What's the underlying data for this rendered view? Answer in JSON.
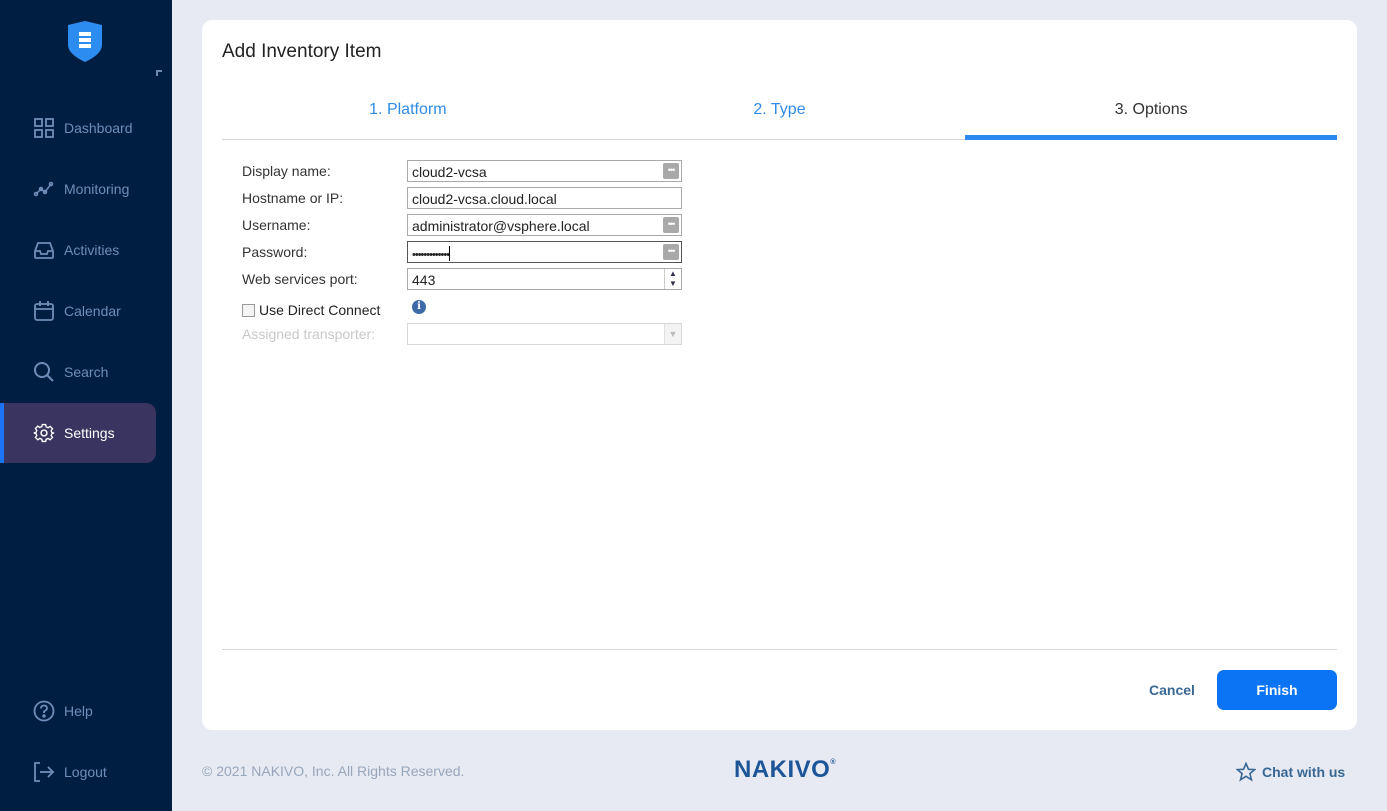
{
  "sidebar": {
    "items": [
      {
        "label": "Dashboard",
        "icon": "dashboard-grid-icon"
      },
      {
        "label": "Monitoring",
        "icon": "monitoring-chart-icon"
      },
      {
        "label": "Activities",
        "icon": "inbox-tray-icon"
      },
      {
        "label": "Calendar",
        "icon": "calendar-icon"
      },
      {
        "label": "Search",
        "icon": "search-icon"
      },
      {
        "label": "Settings",
        "icon": "gear-icon",
        "active": true
      }
    ],
    "bottom_items": [
      {
        "label": "Help",
        "icon": "help-circle-icon"
      },
      {
        "label": "Logout",
        "icon": "logout-icon"
      }
    ]
  },
  "dialog": {
    "title": "Add Inventory Item",
    "steps": [
      {
        "label": "1. Platform"
      },
      {
        "label": "2. Type"
      },
      {
        "label": "3. Options",
        "active": true
      }
    ],
    "form": {
      "display_name": {
        "label": "Display name:",
        "value": "cloud2-vcsa"
      },
      "hostname": {
        "label": "Hostname or IP:",
        "value": "cloud2-vcsa.cloud.local"
      },
      "username": {
        "label": "Username:",
        "value": "administrator@vsphere.local"
      },
      "password": {
        "label": "Password:",
        "value": "•••••••••••••"
      },
      "port": {
        "label": "Web services port:",
        "value": "443"
      },
      "direct_connect": {
        "label": "Use Direct Connect",
        "checked": false
      },
      "transporter": {
        "label": "Assigned transporter:",
        "value": "",
        "disabled": true
      }
    },
    "buttons": {
      "cancel": "Cancel",
      "finish": "Finish"
    }
  },
  "footer": {
    "copyright": "© 2021 NAKIVO, Inc. All Rights Reserved.",
    "brand": "NAKIVO",
    "brand_mark": "®",
    "chat": "Chat with us"
  },
  "colors": {
    "sidebar_bg": "#001e42",
    "accent": "#0a74f5",
    "active_nav_bg": "#3a3560"
  }
}
